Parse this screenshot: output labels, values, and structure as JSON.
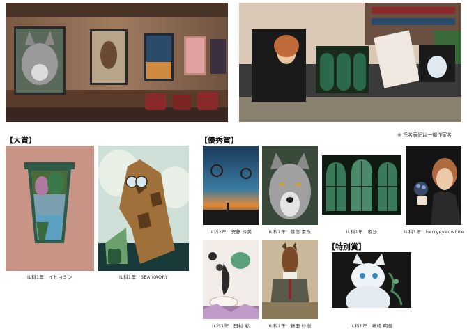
{
  "notice": "※ 氏名表記は一部作家名",
  "sections": {
    "grand_prize": "【大賞】",
    "excellence": "【優秀賞】",
    "special": "【特別賞】"
  },
  "captions": {
    "grand_1": "IL科1年　イヒョミン",
    "grand_2": "IL科1年　SEA KAORY",
    "excellence_1": "IL科2年　安藤 怜美",
    "excellence_2": "IL科1年　篠俣 素珠",
    "excellence_3": "IL科1年　夜沙",
    "excellence_4": "IL科1年　berryeyedwhite",
    "excellence_5": "IL科1年　田村 彩",
    "excellence_6": "IL科1年　藤田 紗樹",
    "special_1": "IL科1年　嶋崎 明音"
  }
}
